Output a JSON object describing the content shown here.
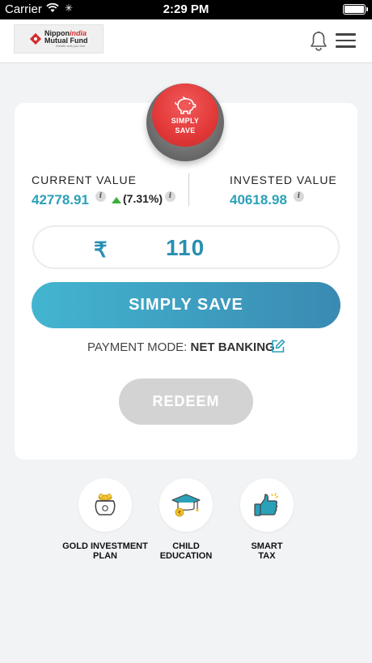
{
  "status_bar": {
    "carrier": "Carrier",
    "time": "2:29 PM"
  },
  "header": {
    "logo": {
      "line1_a": "Nippon",
      "line1_b": "india",
      "line2": "Mutual Fund",
      "tagline": "Wealth sets you free"
    },
    "icons": [
      "bell-icon",
      "menu-icon"
    ]
  },
  "card": {
    "simply_save_badge": "SIMPLY SAVE",
    "current_value_label": "CURRENT VALUE",
    "current_value": "42778.91",
    "change": "(7.31%)",
    "invested_value_label": "INVESTED VALUE",
    "invested_value": "40618.98",
    "currency_symbol": "₹",
    "amount": "110",
    "simply_save_button": "SIMPLY SAVE",
    "payment_mode_label": "PAYMENT MODE:",
    "payment_mode_value": "NET BANKING",
    "redeem_button": "REDEEM"
  },
  "goals": [
    {
      "label_line1": "GOLD INVESTMENT",
      "label_line2": "PLAN",
      "icon": "gold-pot-icon"
    },
    {
      "label_line1": "CHILD",
      "label_line2": "EDUCATION",
      "icon": "graduation-cap-icon"
    },
    {
      "label_line1": "SMART",
      "label_line2": "TAX",
      "icon": "thumbs-up-icon"
    }
  ],
  "colors": {
    "accent": "#2aa1b8",
    "primary_button_start": "#43b5d0",
    "primary_button_end": "#3a8ab2",
    "badge_red": "#e23838",
    "positive_green": "#3cae3c",
    "disabled": "#d3d3d3"
  }
}
